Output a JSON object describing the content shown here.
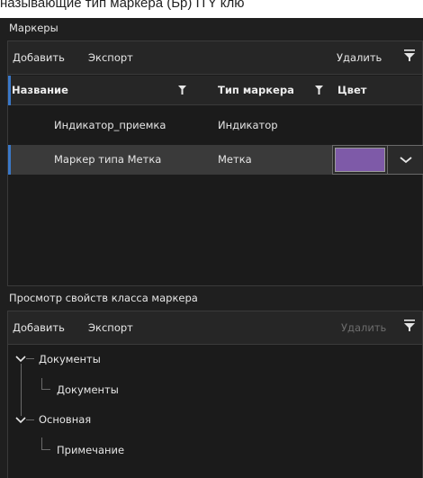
{
  "top_strip": {
    "text": "называющие тип маркера (Бр) ITY клю"
  },
  "markers": {
    "title": "Маркеры",
    "toolbar": {
      "add": "Добавить",
      "export": "Экспорт",
      "delete": "Удалить"
    },
    "columns": {
      "name": "Название",
      "type": "Тип маркера",
      "color": "Цвет"
    },
    "rows": [
      {
        "name": "Индикатор_приемка",
        "type": "Индикатор"
      },
      {
        "name": "Маркер типа Метка",
        "type": "Метка",
        "color": "#7e5aa8"
      }
    ]
  },
  "properties": {
    "title": "Просмотр свойств класса маркера",
    "toolbar": {
      "add": "Добавить",
      "export": "Экспорт",
      "delete": "Удалить"
    },
    "tree": [
      {
        "label": "Документы",
        "children": [
          {
            "label": "Документы"
          }
        ]
      },
      {
        "label": "Основная",
        "children": [
          {
            "label": "Примечание"
          }
        ]
      }
    ]
  },
  "colors": {
    "background": "#1f1f1f",
    "accent": "#3a78c8",
    "selected_row": "#3a3a3a",
    "swatch": "#7e5aa8"
  }
}
